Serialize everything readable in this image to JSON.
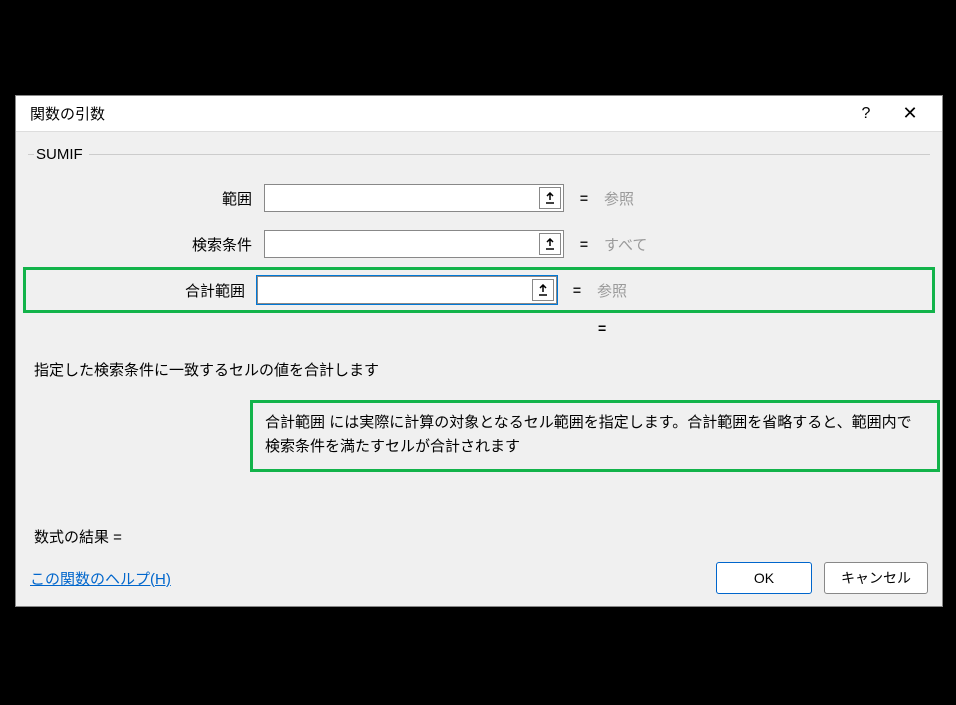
{
  "dialog": {
    "title": "関数の引数"
  },
  "function": {
    "name": "SUMIF",
    "args": {
      "range": {
        "label": "範囲",
        "value": "",
        "hint": "参照"
      },
      "criteria": {
        "label": "検索条件",
        "value": "",
        "hint": "すべて"
      },
      "sum_range": {
        "label": "合計範囲",
        "value": "",
        "hint": "参照"
      }
    },
    "description": "指定した検索条件に一致するセルの値を合計します",
    "arg_help": {
      "name": "合計範囲",
      "text": "には実際に計算の対象となるセル範囲を指定します。合計範囲を省略すると、範囲内で検索条件を満たすセルが合計されます"
    },
    "result_label": "数式の結果 ="
  },
  "footer": {
    "help_link": "この関数のヘルプ(H)",
    "ok": "OK",
    "cancel": "キャンセル"
  },
  "symbols": {
    "equals": "="
  }
}
